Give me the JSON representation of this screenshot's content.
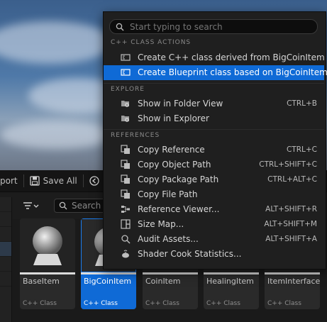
{
  "toolbar": {
    "import_partial": "port",
    "save_all": "Save All"
  },
  "filter": {
    "search_placeholder": "Search"
  },
  "assets": [
    {
      "name": "BaseItem",
      "kind": "C++ Class"
    },
    {
      "name": "BigCoinItem",
      "kind": "C++ Class"
    },
    {
      "name": "CoinItem",
      "kind": "C++ Class"
    },
    {
      "name": "HealingItem",
      "kind": "C++ Class"
    },
    {
      "name": "ItemInterface",
      "kind": "C++ Class"
    }
  ],
  "menu": {
    "search_placeholder": "Start typing to search",
    "sections": {
      "cpp": "C++ CLASS ACTIONS",
      "explore": "EXPLORE",
      "references": "REFERENCES"
    },
    "items": [
      {
        "label": "Create C++ class derived from BigCoinItem",
        "shortcut": ""
      },
      {
        "label": "Create Blueprint class based on BigCoinItem",
        "shortcut": ""
      },
      {
        "label": "Show in Folder View",
        "shortcut": "CTRL+B"
      },
      {
        "label": "Show in Explorer",
        "shortcut": ""
      },
      {
        "label": "Copy Reference",
        "shortcut": "CTRL+C"
      },
      {
        "label": "Copy Object Path",
        "shortcut": "CTRL+SHIFT+C"
      },
      {
        "label": "Copy Package Path",
        "shortcut": "CTRL+ALT+C"
      },
      {
        "label": "Copy File Path",
        "shortcut": ""
      },
      {
        "label": "Reference Viewer...",
        "shortcut": "ALT+SHIFT+R"
      },
      {
        "label": "Size Map...",
        "shortcut": "ALT+SHIFT+M"
      },
      {
        "label": "Audit Assets...",
        "shortcut": "ALT+SHIFT+A"
      },
      {
        "label": "Shader Cook Statistics...",
        "shortcut": ""
      }
    ]
  },
  "colors": {
    "accent": "#0f6ad6",
    "menu_bg": "#1f1f1f"
  }
}
